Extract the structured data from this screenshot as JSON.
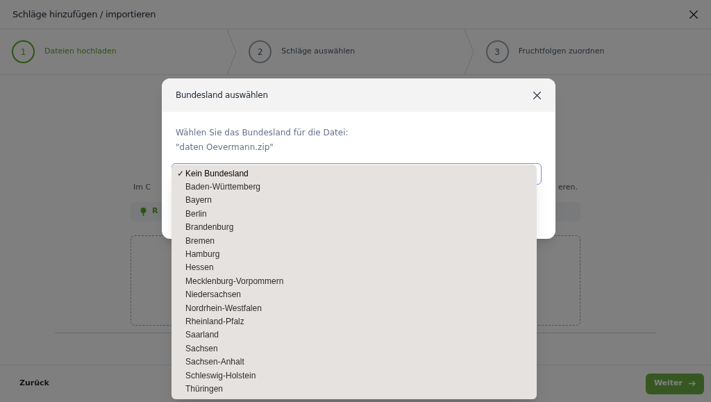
{
  "window": {
    "title": "Schläge hinzufügen / importieren"
  },
  "steps": [
    {
      "number": "1",
      "label": "Dateien hochladen",
      "selected": true
    },
    {
      "number": "2",
      "label": "Schläge auswählen",
      "selected": false
    },
    {
      "number": "3",
      "label": "Fruchtfolgen zuordnen",
      "selected": false
    }
  ],
  "background": {
    "text_left": "Im C",
    "text_right": "eren.",
    "info": "R"
  },
  "footer": {
    "back": "Zurück",
    "next": {
      "label": "Weiter",
      "disabled": true
    }
  },
  "dialog": {
    "title": "Bundesland auswählen",
    "prompt": "Wählen Sie das Bundesland für die Datei:",
    "file": "\"daten Oevermann.zip\"",
    "check_mark": "✓",
    "options": [
      {
        "label": "Kein Bundesland",
        "selected": true
      },
      {
        "label": "Baden-Württemberg",
        "selected": false
      },
      {
        "label": "Bayern",
        "selected": false
      },
      {
        "label": "Berlin",
        "selected": false
      },
      {
        "label": "Brandenburg",
        "selected": false
      },
      {
        "label": "Bremen",
        "selected": false
      },
      {
        "label": "Hamburg",
        "selected": false
      },
      {
        "label": "Hessen",
        "selected": false
      },
      {
        "label": "Mecklenburg-Vorpommern",
        "selected": false
      },
      {
        "label": "Niedersachsen",
        "selected": false
      },
      {
        "label": "Nordrhein-Westfalen",
        "selected": false
      },
      {
        "label": "Rheinland-Pfalz",
        "selected": false
      },
      {
        "label": "Saarland",
        "selected": false
      },
      {
        "label": "Sachsen",
        "selected": false
      },
      {
        "label": "Sachsen-Anhalt",
        "selected": false
      },
      {
        "label": "Schleswig-Holstein",
        "selected": false
      },
      {
        "label": "Thüringen",
        "selected": false
      }
    ]
  }
}
